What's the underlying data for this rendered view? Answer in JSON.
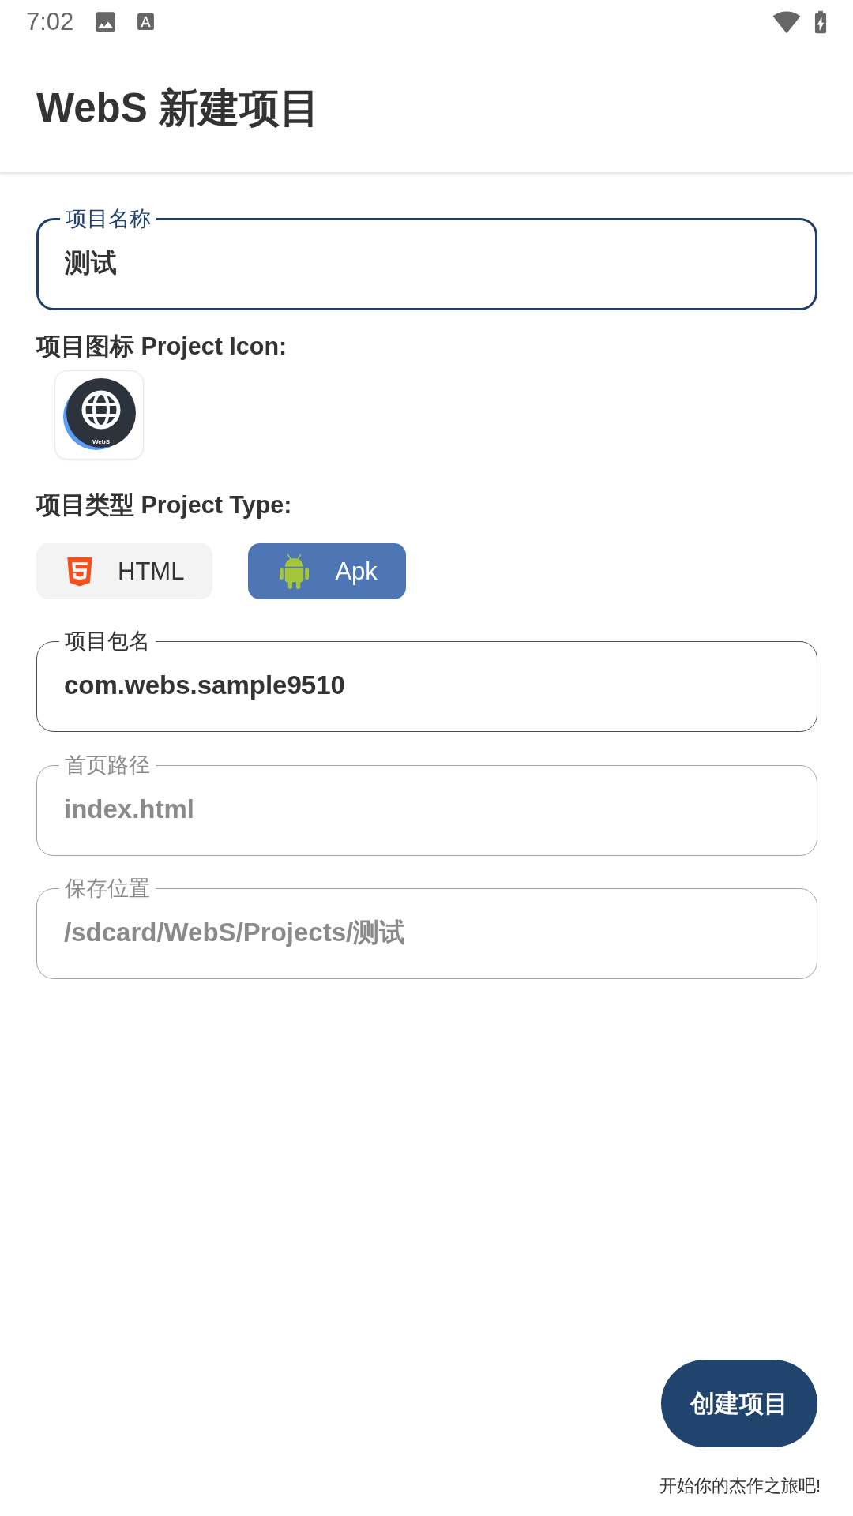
{
  "status_bar": {
    "time": "7:02"
  },
  "app_bar": {
    "title": "WebS 新建项目"
  },
  "name_field": {
    "label": "项目名称",
    "value": "测试",
    "focused": true,
    "disabled": false
  },
  "icon_section": {
    "label": "项目图标 Project Icon:",
    "icon_caption": "WebS"
  },
  "type_section": {
    "label": "项目类型 Project Type:",
    "options": [
      {
        "kind": "html",
        "label": "HTML",
        "selected": false
      },
      {
        "kind": "apk",
        "label": "Apk",
        "selected": true
      }
    ]
  },
  "fields": [
    {
      "label": "项目包名",
      "value": "com.webs.sample9510",
      "focused": false,
      "disabled": false
    },
    {
      "label": "首页路径",
      "value": "index.html",
      "focused": false,
      "disabled": true
    },
    {
      "label": "保存位置",
      "value": "/sdcard/WebS/Projects/测试",
      "focused": false,
      "disabled": true
    }
  ],
  "create_button": {
    "label": "创建项目"
  },
  "footer": {
    "text": "开始你的杰作之旅吧!"
  }
}
